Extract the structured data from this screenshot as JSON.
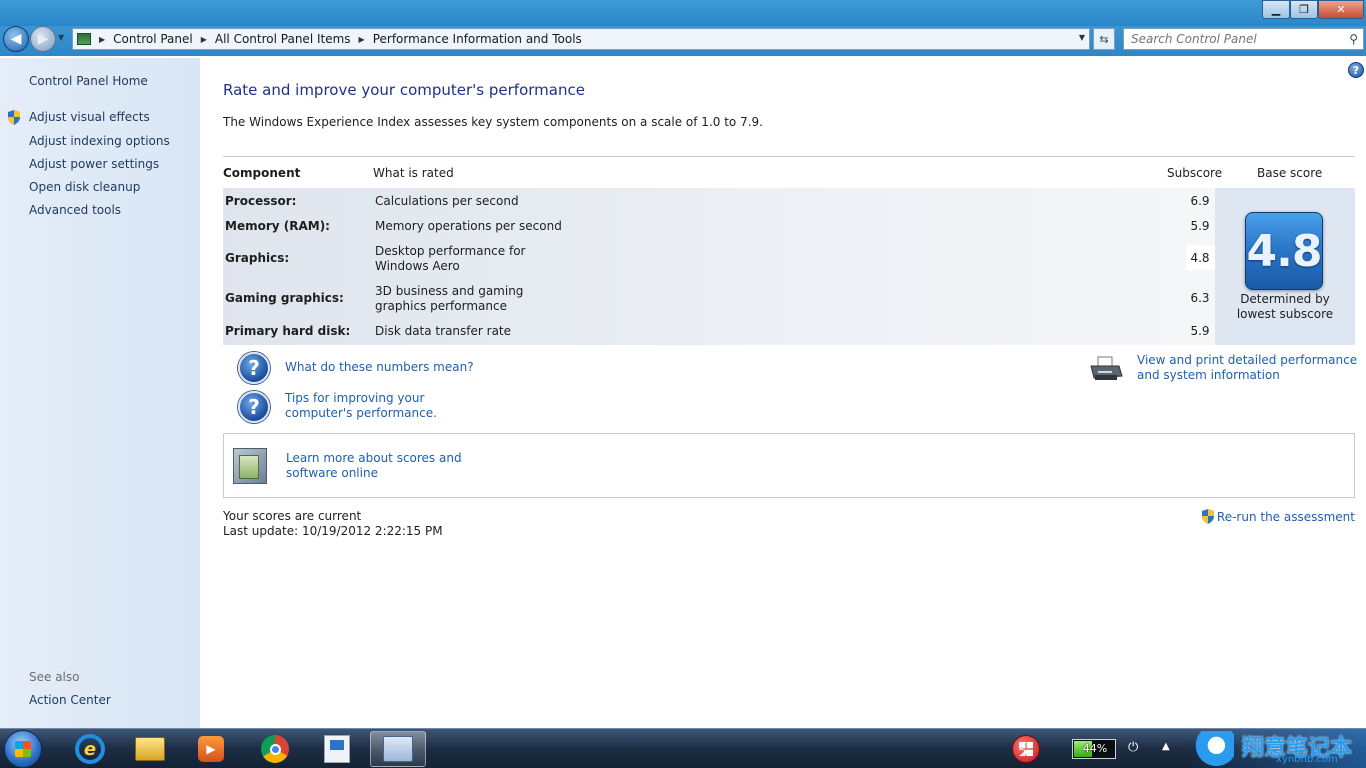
{
  "window": {
    "minimize": "▁",
    "maximize": "❐",
    "close": "✕"
  },
  "address": {
    "crumbs": [
      "Control Panel",
      "All Control Panel Items",
      "Performance Information and Tools"
    ],
    "search_placeholder": "Search Control Panel"
  },
  "sidebar": {
    "home": "Control Panel Home",
    "items": [
      {
        "label": "Adjust visual effects",
        "shield": true
      },
      {
        "label": "Adjust indexing options",
        "shield": false
      },
      {
        "label": "Adjust power settings",
        "shield": false
      },
      {
        "label": "Open disk cleanup",
        "shield": false
      },
      {
        "label": "Advanced tools",
        "shield": false
      }
    ],
    "see_also": "See also",
    "action_center": "Action Center"
  },
  "main": {
    "title": "Rate and improve your computer's performance",
    "intro": "The Windows Experience Index assesses key system components on a scale of 1.0 to 7.9.",
    "headers": {
      "component": "Component",
      "what": "What is rated",
      "subscore": "Subscore",
      "base": "Base score"
    },
    "rows": [
      {
        "component": "Processor:",
        "what": "Calculations per second",
        "subscore": "6.9"
      },
      {
        "component": "Memory (RAM):",
        "what": "Memory operations per second",
        "subscore": "5.9"
      },
      {
        "component": "Graphics:",
        "what": "Desktop performance for Windows Aero",
        "subscore": "4.8"
      },
      {
        "component": "Gaming graphics:",
        "what": "3D business and gaming graphics performance",
        "subscore": "6.3"
      },
      {
        "component": "Primary hard disk:",
        "what": "Disk data transfer rate",
        "subscore": "5.9"
      }
    ],
    "base_score": "4.8",
    "base_note": "Determined by lowest subscore",
    "links": {
      "numbers": "What do these numbers mean?",
      "tips": "Tips for improving your computer's performance.",
      "print": "View and print detailed performance and system information",
      "learn": "Learn more about scores and software online",
      "rerun": "Re-run the assessment"
    },
    "status": "Your scores are current",
    "last_update": "Last update: 10/19/2012 2:22:15 PM"
  },
  "taskbar": {
    "battery_percent": 44,
    "battery_label": "44%",
    "watermark_cn": "翔意笔记本",
    "watermark_en": "xynbnb.com"
  },
  "colors": {
    "link": "#1e5fb0",
    "title": "#1e3287",
    "sidebar_link": "#1e395b"
  }
}
